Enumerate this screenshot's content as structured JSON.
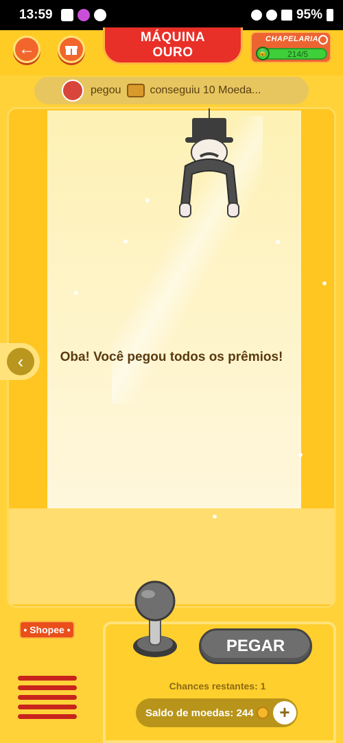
{
  "status": {
    "time": "13:59",
    "battery": "95%"
  },
  "header": {
    "title_line1": "MÁQUINA",
    "title_line2": "OURO",
    "chapelaria_label": "CHAPELARIA",
    "chapelaria_count": "214/5",
    "back_icon": "arrow-left-icon",
    "gift_icon": "gift-icon"
  },
  "ticker": {
    "text1": "pegou",
    "text2": "conseguiu 10 Moeda..."
  },
  "main": {
    "message": "Oba! Você pegou todos os prêmios!"
  },
  "bottom": {
    "shopee_label": "• Shopee •",
    "pegar_label": "PEGAR",
    "chances_label": "Chances restantes: 1",
    "saldo_label": "Saldo de moedas: 244",
    "plus_icon": "plus-icon"
  },
  "colors": {
    "accent": "#e82f28",
    "machine": "#ffc521",
    "button_orange": "#f2662b"
  }
}
